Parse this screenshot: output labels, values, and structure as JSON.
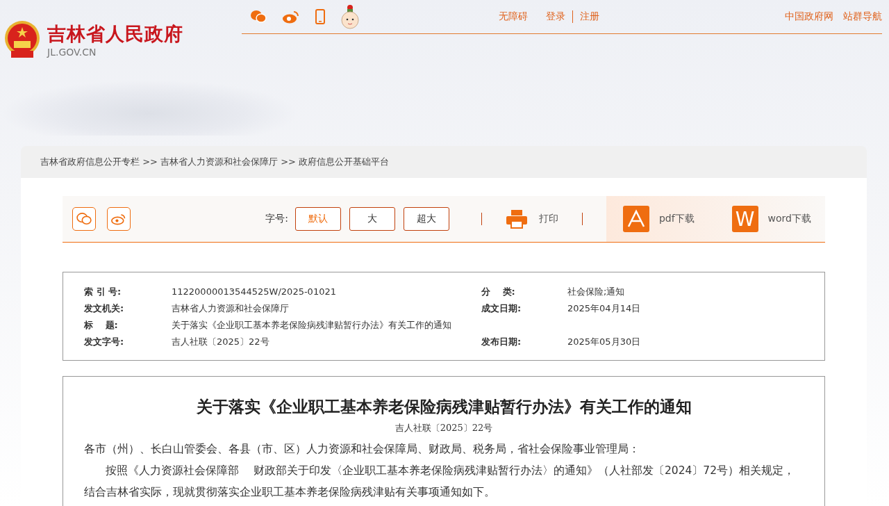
{
  "site": {
    "name": "吉林省人民政府",
    "domain": "JL.GOV.CN"
  },
  "top_links": [
    "无障碍",
    "登录",
    "注册"
  ],
  "right_links": [
    "中国政府网",
    "站群导航"
  ],
  "breadcrumb": "吉林省政府信息公开专栏 >> 吉林省人力资源和社会保障厅 >> 政府信息公开基础平台",
  "toolbar": {
    "font_label": "字号:",
    "font_sizes": [
      {
        "label": "默认",
        "selected": true
      },
      {
        "label": "大",
        "selected": false
      },
      {
        "label": "超大",
        "selected": false
      }
    ],
    "print": "打印",
    "pdf": "pdf下载",
    "word": "word下载",
    "word_icon": "W"
  },
  "meta": [
    {
      "label": "索 引 号:",
      "value": "11220000013544525W/2025-01021",
      "label2": "分　 类:",
      "value2": "社会保险;通知"
    },
    {
      "label": "发文机关:",
      "value": "吉林省人力资源和社会保障厅",
      "label2": "成文日期:",
      "value2": "2025年04月14日"
    },
    {
      "label": "标　 题:",
      "value": "关于落实《企业职工基本养老保险病残津贴暂行办法》有关工作的通知"
    },
    {
      "label": "发文字号:",
      "value": "吉人社联〔2025〕22号",
      "label2": "发布日期:",
      "value2": "2025年05月30日"
    }
  ],
  "article": {
    "title": "关于落实《企业职工基本养老保险病残津贴暂行办法》有关工作的通知",
    "doc_number": "吉人社联〔2025〕22号",
    "paragraphs": [
      {
        "kind": "address",
        "text": "各市（州）、长白山管委会、各县（市、区）人力资源和社会保障局、财政局、税务局，省社会保险事业管理局："
      },
      {
        "kind": "body",
        "text": "按照《人力资源社会保障部　 财政部关于印发〈企业职工基本养老保险病残津贴暂行办法〉的通知》（人社部发〔2024〕72号）相关规定，结合吉林省实际，现就贯彻落实企业职工基本养老保险病残津贴有关事项通知如下。"
      }
    ]
  }
}
